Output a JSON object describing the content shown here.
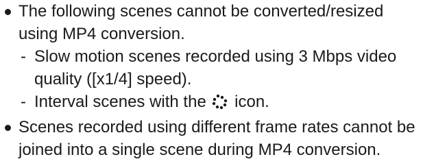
{
  "notes": {
    "item1": {
      "line1": "The following scenes cannot be converted/resized",
      "line2": "using MP4 conversion.",
      "sub1_line1": "Slow motion scenes recorded using 3 Mbps video",
      "sub1_line2": "quality ([x1/4] speed).",
      "sub2_before": "Interval scenes with the",
      "sub2_after": "icon."
    },
    "item2": {
      "line1": "Scenes recorded using different frame rates cannot be",
      "line2": "joined into a single scene during MP4 conversion."
    },
    "dash": "-",
    "interval_icon_name": "interval-icon"
  }
}
